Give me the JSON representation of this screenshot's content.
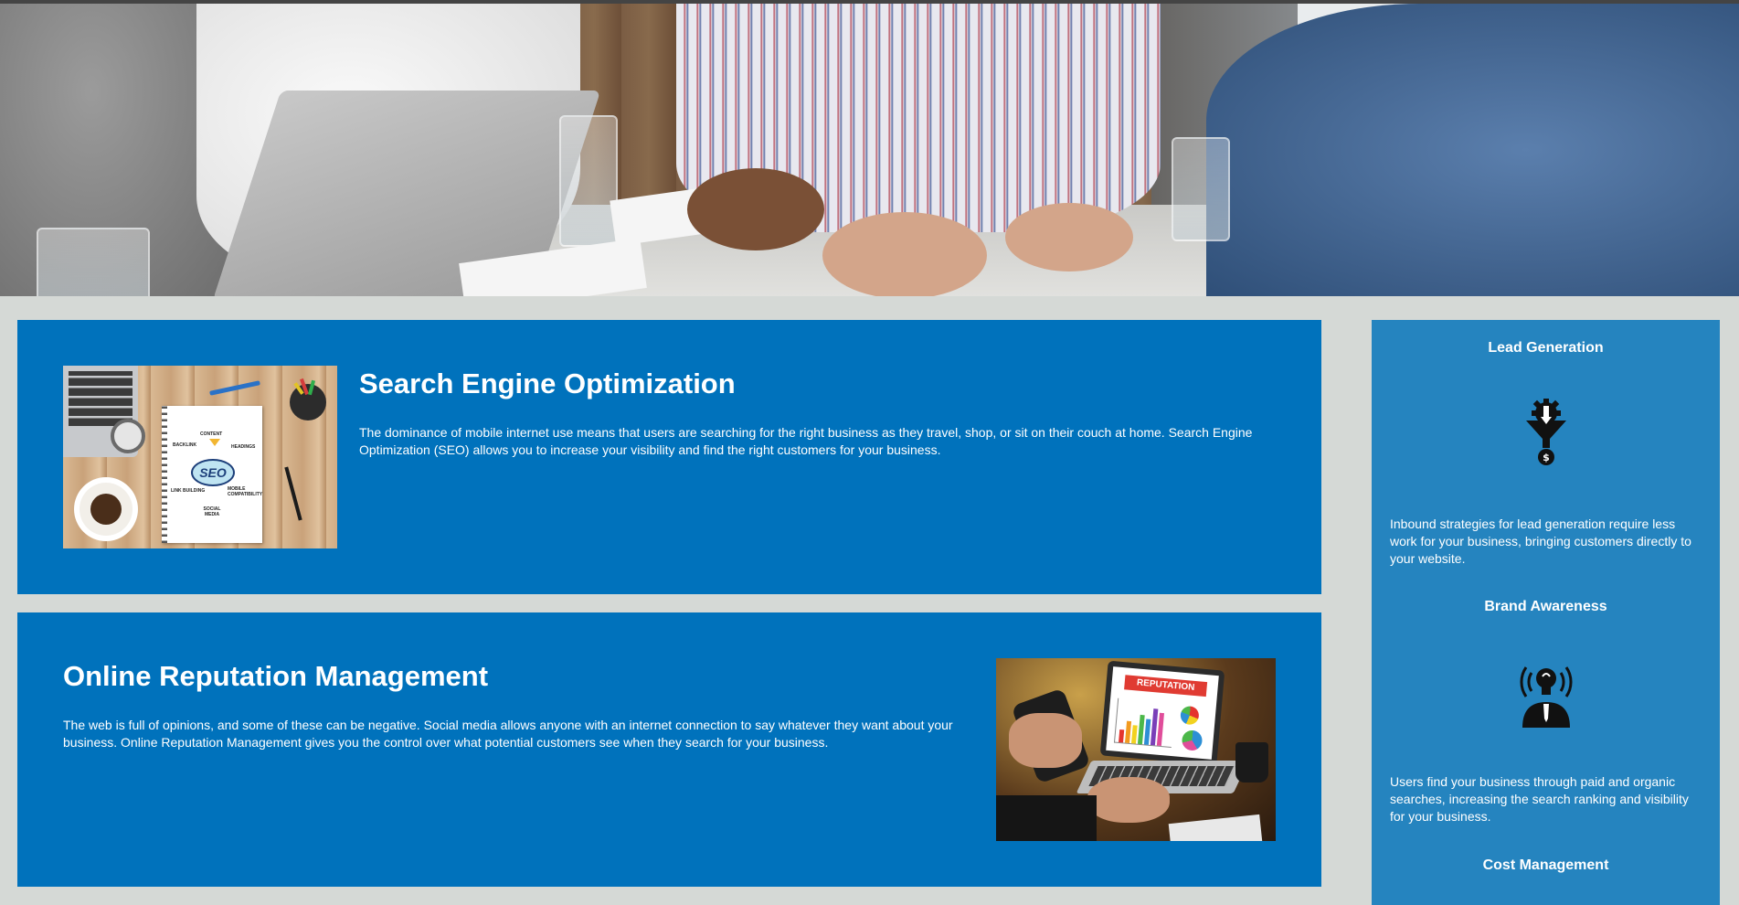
{
  "colors": {
    "background": "#d5d9d6",
    "panel_blue": "#0072bc",
    "sidebar_blue": "#2584bf",
    "text": "#ffffff"
  },
  "hero": {
    "image": "business-meeting-photo"
  },
  "articles": [
    {
      "heading": "Search Engine Optimization",
      "body": "The dominance of mobile internet use means that users are searching for the right business as they travel, shop, or sit on their couch at home. Search Engine Optimization (SEO) allows you to increase your visibility and find the right customers for your business.",
      "image": "seo-notebook-image",
      "image_words": [
        "CONTENT",
        "BACKLINK",
        "HEADINGS",
        "SEO",
        "LINK BUILDING",
        "MOBILE COMPATIBILITY",
        "SOCIAL MEDIA"
      ]
    },
    {
      "heading": "Online Reputation Management",
      "body": "The web is full of opinions, and some of these can be negative. Social media allows anyone with an internet connection to say whatever they want about your business. Online Reputation Management gives you the control over what potential customers see when they search for your business.",
      "image": "reputation-laptop-image",
      "image_words": [
        "REPUTATION"
      ]
    }
  ],
  "sidebar": {
    "items": [
      {
        "title": "Lead Generation",
        "icon": "funnel-gear-dollar-icon",
        "body": "Inbound strategies for lead generation require less work for your business, bringing customers directly to your website."
      },
      {
        "title": "Brand Awareness",
        "icon": "lightbulb-head-icon",
        "body": "Users find your business through paid and organic searches, increasing the search ranking and visibility for your business."
      },
      {
        "title": "Cost Management",
        "icon": "",
        "body": ""
      }
    ]
  }
}
